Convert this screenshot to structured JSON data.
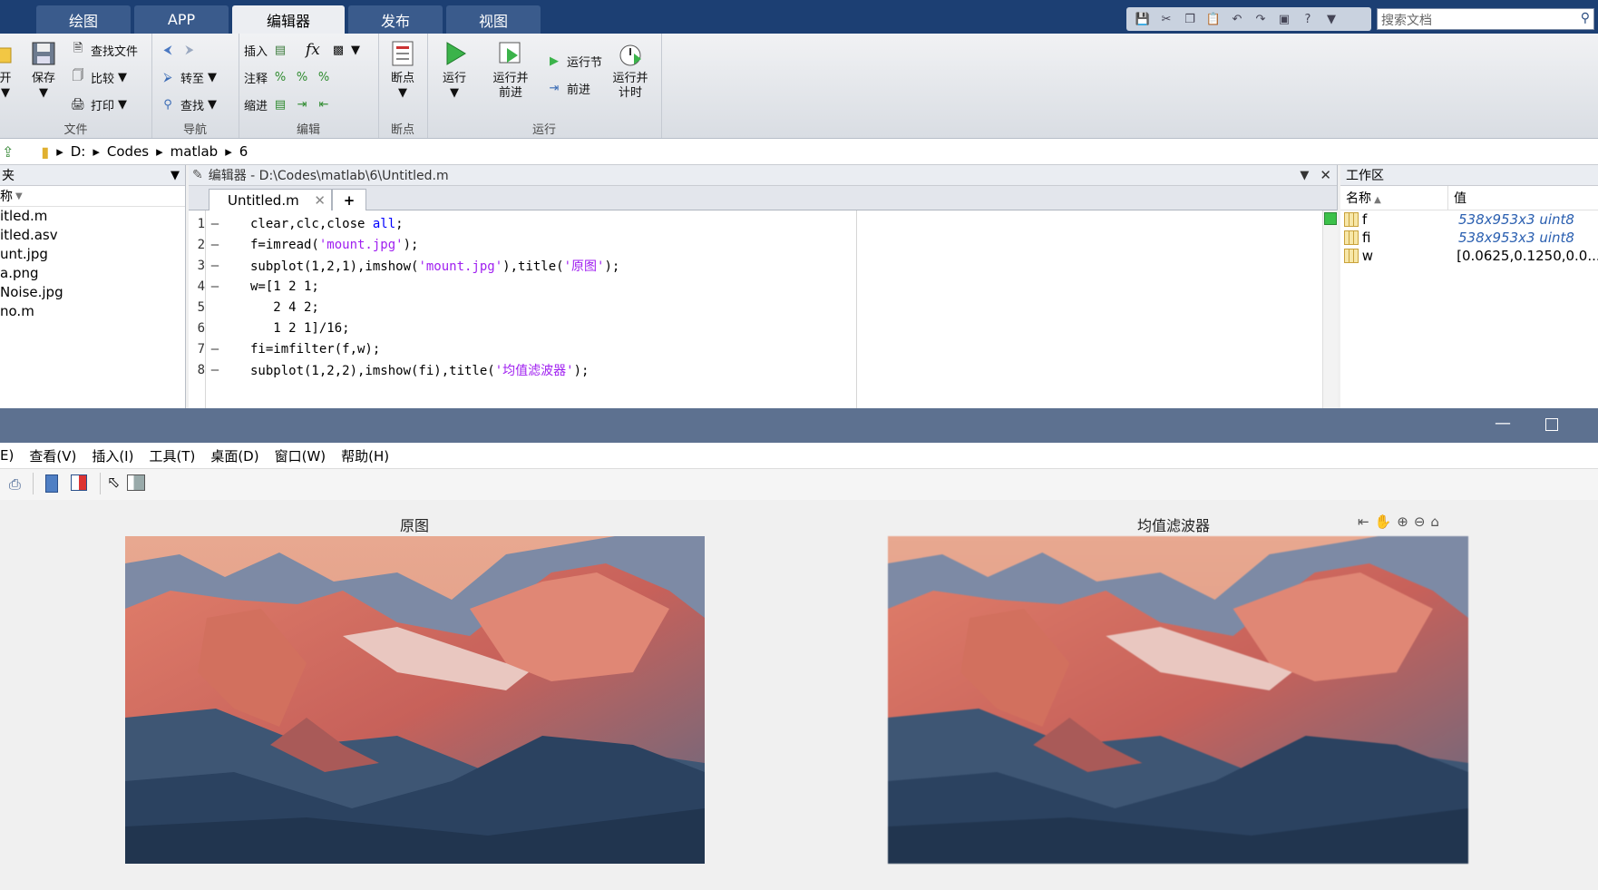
{
  "ribbon_tabs": [
    "绘图",
    "APP",
    "编辑器",
    "发布",
    "视图"
  ],
  "active_tab": "编辑器",
  "search": {
    "placeholder": "搜索文档"
  },
  "ribbon": {
    "file": {
      "open": "开",
      "save": "保存",
      "find_files": "查找文件",
      "compare": "比较",
      "print": "打印",
      "group": "文件"
    },
    "nav": {
      "goto": "转至",
      "find": "查找",
      "group": "导航"
    },
    "edit": {
      "insert": "插入",
      "comment": "注释",
      "indent": "缩进",
      "fx": "fx",
      "group": "编辑"
    },
    "breakpoints": {
      "label": "断点",
      "group": "断点"
    },
    "run": {
      "run": "运行",
      "run_advance_1": "运行并",
      "run_advance_2": "前进",
      "run_section": "运行节",
      "advance": "前进",
      "run_time_1": "运行并",
      "run_time_2": "计时",
      "group": "运行"
    }
  },
  "address": {
    "drive": "D:",
    "parts": [
      "Codes",
      "matlab",
      "6"
    ]
  },
  "files": {
    "header": "称",
    "items": [
      "itled.m",
      "itled.asv",
      "unt.jpg",
      "a.png",
      "Noise.jpg",
      "no.m"
    ]
  },
  "editor": {
    "title": "编辑器 - D:\\Codes\\matlab\\6\\Untitled.m",
    "tab": "Untitled.m",
    "lines": [
      {
        "n": "1",
        "dash": "—",
        "segs": [
          [
            "clear,clc,close ",
            ""
          ],
          [
            "all",
            "kw"
          ],
          [
            ";",
            ""
          ]
        ]
      },
      {
        "n": "2",
        "dash": "—",
        "segs": [
          [
            "f=imread(",
            ""
          ],
          [
            "'mount.jpg'",
            "str"
          ],
          [
            ");",
            ""
          ]
        ]
      },
      {
        "n": "3",
        "dash": "—",
        "segs": [
          [
            "subplot(1,2,1),imshow(",
            ""
          ],
          [
            "'mount.jpg'",
            "str"
          ],
          [
            "),title(",
            ""
          ],
          [
            "'原图'",
            "str"
          ],
          [
            ");",
            ""
          ]
        ]
      },
      {
        "n": "4",
        "dash": "—",
        "segs": [
          [
            "w=[1 2 1;",
            ""
          ]
        ]
      },
      {
        "n": "5",
        "dash": "",
        "segs": [
          [
            "   2 4 2;",
            ""
          ]
        ]
      },
      {
        "n": "6",
        "dash": "",
        "segs": [
          [
            "   1 2 1]/16;",
            ""
          ]
        ]
      },
      {
        "n": "7",
        "dash": "—",
        "segs": [
          [
            "fi=imfilter(f,w);",
            ""
          ]
        ]
      },
      {
        "n": "8",
        "dash": "—",
        "segs": [
          [
            "subplot(1,2,2),imshow(fi),title(",
            ""
          ],
          [
            "'均值滤波器'",
            "str"
          ],
          [
            ");",
            ""
          ]
        ]
      }
    ]
  },
  "workspace": {
    "title": "工作区",
    "col_name": "名称",
    "col_value": "值",
    "vars": [
      {
        "name": "f",
        "value": "538x953x3 uint8"
      },
      {
        "name": "fi",
        "value": "538x953x3 uint8"
      },
      {
        "name": "w",
        "value": "[0.0625,0.1250,0.0..."
      }
    ]
  },
  "figure": {
    "menu": [
      "E)",
      "查看(V)",
      "插入(I)",
      "工具(T)",
      "桌面(D)",
      "窗口(W)",
      "帮助(H)"
    ],
    "left_title": "原图",
    "right_title": "均值滤波器"
  }
}
